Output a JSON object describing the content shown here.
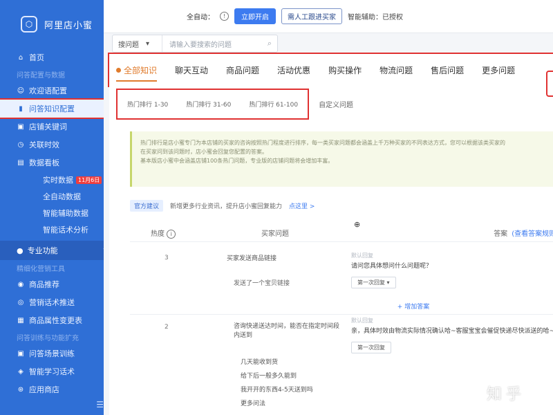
{
  "app": {
    "title": "阿里店小蜜"
  },
  "sidebar": {
    "items": [
      {
        "label": "首页",
        "icon": "home-icon"
      },
      {
        "label": "问答配置与数据",
        "group": true
      },
      {
        "label": "欢迎语配置",
        "icon": "smile-icon"
      },
      {
        "label": "问答知识配置",
        "icon": "doc-icon",
        "active": true
      },
      {
        "label": "店铺关键词",
        "icon": "key-icon"
      },
      {
        "label": "关联时效",
        "icon": "clock-icon"
      },
      {
        "label": "数据看板",
        "icon": "chart-icon"
      }
    ],
    "sub_items": [
      {
        "label": "实时数据",
        "badge": "11月6日"
      },
      {
        "label": "全自动数据"
      },
      {
        "label": "智能辅助数据"
      },
      {
        "label": "智能话术分析"
      }
    ],
    "section": {
      "label": "专业功能"
    },
    "group2": "精细化营销工具",
    "items2": [
      {
        "label": "商品推荐",
        "icon": "gift-icon"
      },
      {
        "label": "营销话术推送",
        "icon": "megaphone-icon"
      },
      {
        "label": "商品属性变更表",
        "icon": "table-icon"
      }
    ],
    "group3": "问答训练与功能扩充",
    "items3": [
      {
        "label": "问答场景训练",
        "icon": "train-icon"
      },
      {
        "label": "智能学习话术",
        "icon": "bulb-icon"
      },
      {
        "label": "应用商店",
        "icon": "store-icon"
      }
    ],
    "footer_icon": "menu-icon"
  },
  "topbar": {
    "auto_label": "全自动：",
    "enable_button": "立即开启",
    "manual_button": "需人工跟进买家",
    "assist_label": "智能辅助：已授权"
  },
  "search": {
    "select_value": "搜问题",
    "placeholder": "请输入要搜索的问题"
  },
  "category_tabs": [
    {
      "label": "全部知识",
      "active": true
    },
    {
      "label": "聊天互动"
    },
    {
      "label": "商品问题"
    },
    {
      "label": "活动优惠"
    },
    {
      "label": "购买操作"
    },
    {
      "label": "物流问题"
    },
    {
      "label": "售后问题"
    },
    {
      "label": "更多问题"
    }
  ],
  "range_tabs": [
    {
      "label": "热门排行 1-30"
    },
    {
      "label": "热门排行 31-60"
    },
    {
      "label": "热门排行 61-100"
    }
  ],
  "custom_question": "自定义问题",
  "notice": {
    "line1": "热门排行是店小蜜专门为本店铺的买家的咨询按照热门程度进行排序，每一类买家问题都会涵盖上千万种买家的不同表达方式，您可以根据该类买家的",
    "line2": "在买家问到该问题时，店小蜜会回复您配置的答案。",
    "line3": "基本版店小蜜中会涵盖店铺100条热门问题，专业版的店铺问题将会增加丰富。"
  },
  "suggest": {
    "tag": "官方建议",
    "text": "新增更多行业资讯，提升店小蜜回复能力",
    "link": "点这里 >"
  },
  "table": {
    "col_heat": "热度",
    "col_question": "买家问题",
    "col_answer": "答案",
    "col_answer_link": "(查看答案规则)",
    "rows": [
      {
        "rank": "3",
        "question_prefix": "",
        "question": "买家发送商品链接",
        "sub_question": "发送了一个宝贝链接",
        "answer_label": "默认回复",
        "answer_text": "请问您具体想问什么问题呢？",
        "answer_select": "第一次回复"
      },
      {
        "rank": "2",
        "question": "咨询快递送达时间，能否在指定时间段内送到",
        "answer_label": "默认回复",
        "answer_text": "亲，具体时效由物流实际情况确认哈~客服宝宝会催促快递尽快派送的哈~",
        "answer_select": "第一次回复",
        "list": [
          "几天能收到货",
          "给下后一般多久能到",
          "我开开的东西4-5天送到吗",
          "更多问法"
        ]
      }
    ],
    "add_answer": "+ 增加答案"
  },
  "watermark": "知乎"
}
